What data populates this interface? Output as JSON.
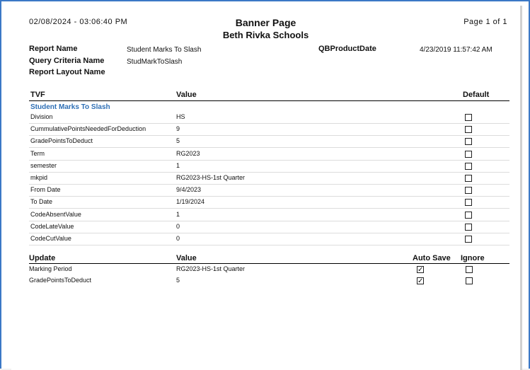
{
  "header": {
    "datetime": "02/08/2024  -  03:06:40  PM",
    "title": "Banner Page",
    "subtitle": "Beth Rivka Schools",
    "page": "Page 1 of 1"
  },
  "meta": {
    "report_name_label": "Report Name",
    "report_name_value": "Student Marks To Slash",
    "query_criteria_label": "Query Criteria Name",
    "query_criteria_value": "StudMarkToSlash",
    "report_layout_label": "Report Layout Name",
    "qbproductdate_label": "QBProductDate",
    "qbproductdate_value": "4/23/2019 11:57:42 AM"
  },
  "tvf_table": {
    "col_tvf": "TVF",
    "col_value": "Value",
    "col_default": "Default",
    "group": "Student Marks To Slash",
    "rows": [
      {
        "name": "Division",
        "value": "HS",
        "default": false
      },
      {
        "name": "CummulativePointsNeededForDeduction",
        "value": "9",
        "default": false
      },
      {
        "name": "GradePointsToDeduct",
        "value": "5",
        "default": false
      },
      {
        "name": "Term",
        "value": "RG2023",
        "default": false
      },
      {
        "name": "semester",
        "value": "1",
        "default": false
      },
      {
        "name": "mkpid",
        "value": "RG2023-HS-1st Quarter",
        "default": false
      },
      {
        "name": "From Date",
        "value": "9/4/2023",
        "default": false
      },
      {
        "name": "To Date",
        "value": "1/19/2024",
        "default": false
      },
      {
        "name": "CodeAbsentValue",
        "value": "1",
        "default": false
      },
      {
        "name": "CodeLateValue",
        "value": "0",
        "default": false
      },
      {
        "name": "CodeCutValue",
        "value": "0",
        "default": false
      }
    ]
  },
  "update_table": {
    "col_update": "Update",
    "col_value": "Value",
    "col_autosave": "Auto Save",
    "col_ignore": "Ignore",
    "rows": [
      {
        "name": "Marking Period",
        "value": "RG2023-HS-1st Quarter",
        "auto_save": true,
        "ignore": false
      },
      {
        "name": "GradePointsToDeduct",
        "value": "5",
        "auto_save": true,
        "ignore": false
      }
    ]
  },
  "colors": {
    "frame_border": "#3b78c6",
    "group_text": "#2e6fb5"
  }
}
